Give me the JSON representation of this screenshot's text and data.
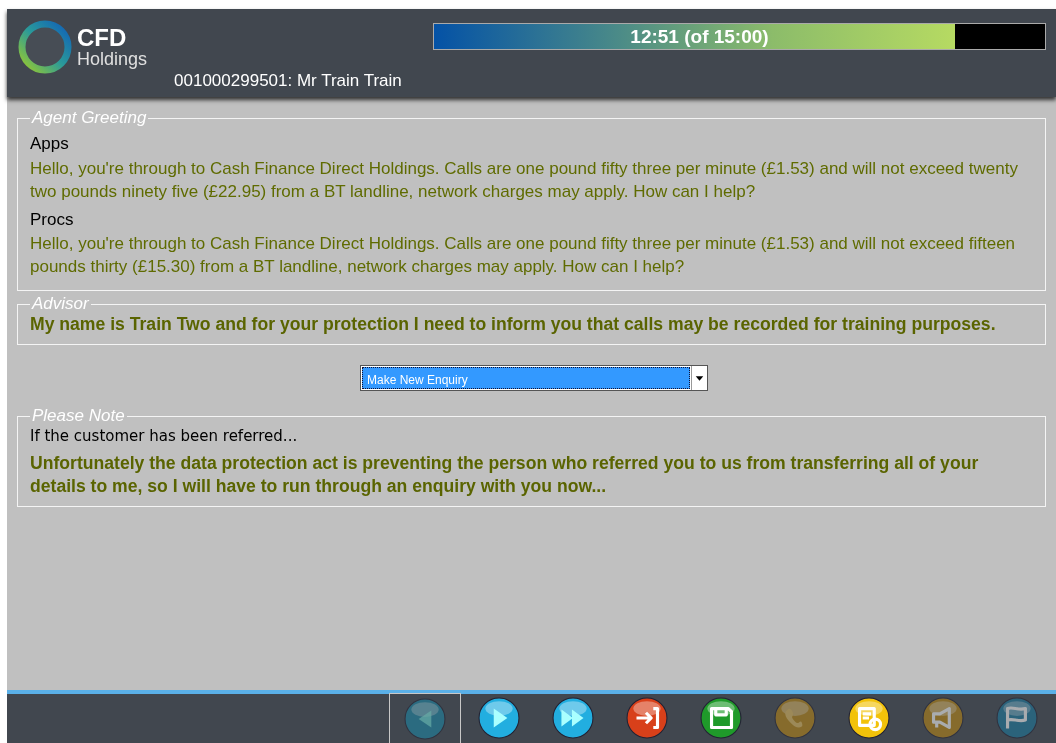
{
  "header": {
    "logo": {
      "title": "CFD",
      "subtitle": "Holdings"
    },
    "customer": "001000299501: Mr Train Train",
    "timer": {
      "text": "12:51 (of 15:00)",
      "level": 0.853
    }
  },
  "sections": [
    {
      "legend": "Agent Greeting",
      "blocks": [
        {
          "kind": "heading",
          "text": "Apps"
        },
        {
          "kind": "script",
          "text": "Hello, you're through to Cash Finance Direct Holdings. Calls are one pound fifty three per minute (£1.53) and will not exceed twenty two pounds ninety five (£22.95) from a BT landline, network charges may apply. How can I help?"
        },
        {
          "kind": "heading",
          "text": "Procs"
        },
        {
          "kind": "script",
          "text": "Hello, you're through to Cash Finance Direct Holdings. Calls are one pound fifty three per minute (£1.53) and will not exceed fifteen pounds thirty (£15.30) from a BT landline, network charges may apply. How can I help?"
        }
      ]
    },
    {
      "legend": "Advisor",
      "blocks": [
        {
          "kind": "statement",
          "text": "My name is Train Two and for your protection I need to inform you that calls may be recorded for training purposes."
        }
      ]
    },
    {
      "kind": "dropdown",
      "value": "Make New Enquiry"
    },
    {
      "legend": "Please Note",
      "blocks": [
        {
          "kind": "condition",
          "text": "If the customer has been referred..."
        },
        {
          "kind": "statement",
          "text": "Unfortunately the data protection act is preventing the person who referred you to us from transferring all of your details to me, so I will have to run through an enquiry with you now..."
        }
      ]
    }
  ],
  "toolbar": [
    {
      "kind": "back",
      "selected": true,
      "disabled": true
    },
    {
      "kind": "play",
      "selected": false,
      "disabled": false
    },
    {
      "kind": "forward",
      "selected": false,
      "disabled": false
    },
    {
      "kind": "exit",
      "selected": false,
      "disabled": false
    },
    {
      "kind": "save",
      "selected": false,
      "disabled": false
    },
    {
      "kind": "phone",
      "selected": false,
      "disabled": true
    },
    {
      "kind": "note",
      "selected": false,
      "disabled": false
    },
    {
      "kind": "megaphone",
      "selected": false,
      "disabled": true
    },
    {
      "kind": "flag",
      "selected": false,
      "disabled": true
    }
  ]
}
